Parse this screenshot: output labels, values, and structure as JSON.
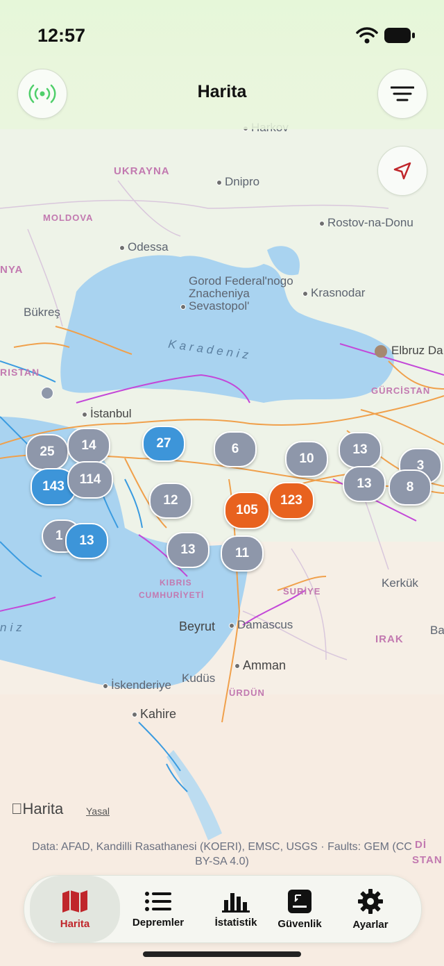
{
  "status": {
    "time": "12:57"
  },
  "nav": {
    "title": "Harita"
  },
  "map": {
    "countries": [
      "UKRAYNA",
      "MOLDOVA",
      "NYA",
      "RISTAN",
      "GÜRCİSTAN",
      "KIBRIS",
      "CUMHURİYETİ",
      "SURİYE",
      "IRAK",
      "ÜRDÜN"
    ],
    "cities": [
      "Harkov",
      "Dnipro",
      "Rostov-na-Donu",
      "Odessa",
      "Gorod Federal'nogo",
      "Znacheniya",
      "Sevastopol'",
      "Krasnodar",
      "Bükreş",
      "Elbruz Da",
      "İstanbul",
      "Kerkük",
      "Beyrut",
      "Damascus",
      "Amman",
      "Kudüs",
      "İskenderiye",
      "Kahire",
      "Ba"
    ],
    "seas": [
      "Karadeniz",
      "niz"
    ],
    "clusters": [
      {
        "label": "25",
        "color": "gray"
      },
      {
        "label": "14",
        "color": "gray"
      },
      {
        "label": "27",
        "color": "blue"
      },
      {
        "label": "6",
        "color": "gray"
      },
      {
        "label": "10",
        "color": "gray"
      },
      {
        "label": "13",
        "color": "gray"
      },
      {
        "label": "3",
        "color": "gray"
      },
      {
        "label": "143",
        "color": "blue"
      },
      {
        "label": "114",
        "color": "gray"
      },
      {
        "label": "12",
        "color": "gray"
      },
      {
        "label": "105",
        "color": "orange"
      },
      {
        "label": "123",
        "color": "orange"
      },
      {
        "label": "13",
        "color": "gray"
      },
      {
        "label": "8",
        "color": "gray"
      },
      {
        "label": "1",
        "color": "gray"
      },
      {
        "label": "13",
        "color": "blue"
      },
      {
        "label": "13",
        "color": "gray"
      },
      {
        "label": "11",
        "color": "gray"
      }
    ],
    "logo": "Harita",
    "legal": "Yasal",
    "attribution": "Data: AFAD, Kandilli Rasathanesi (KOERI), EMSC, USGS · Faults: GEM (CC BY-SA 4.0)",
    "right_edge_labels": [
      "Dİ",
      "STAN"
    ]
  },
  "tabs": [
    {
      "label": "Harita",
      "icon": "map-icon",
      "active": true
    },
    {
      "label": "Depremler",
      "icon": "list-icon",
      "active": false
    },
    {
      "label": "İstatistik",
      "icon": "bar-chart-icon",
      "active": false
    },
    {
      "label": "Güvenlik",
      "icon": "safety-card-icon",
      "active": false
    },
    {
      "label": "Ayarlar",
      "icon": "gear-icon",
      "active": false
    }
  ],
  "colors": {
    "accent": "#c0262b",
    "cluster_gray": "#8e97aa",
    "cluster_blue": "#3d95d9",
    "cluster_orange": "#e8621f",
    "fault_orange": "#f0a04b",
    "fault_blue": "#3a9be0",
    "fault_purple": "#c348d8",
    "sea": "#a9d3f0"
  }
}
